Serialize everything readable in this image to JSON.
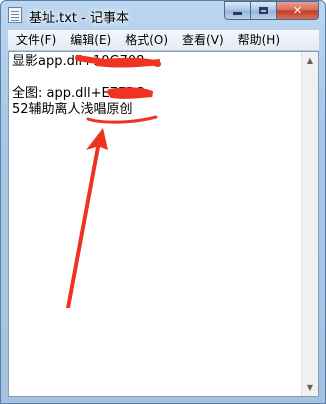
{
  "window": {
    "title": "基址.txt - 记事本",
    "close_glyph": "✕"
  },
  "menu": {
    "items": [
      {
        "label": "文件(F)"
      },
      {
        "label": "编辑(E)"
      },
      {
        "label": "格式(O)"
      },
      {
        "label": "查看(V)"
      },
      {
        "label": "帮助(H)"
      }
    ]
  },
  "editor": {
    "lines": [
      "显影app.dll+10G708",
      "",
      "全图: app.dll+E7EBC",
      "52辅助离人浅唱原创"
    ]
  },
  "annotation": {
    "color": "#ee3322",
    "scribble_lines": [
      1,
      3
    ],
    "underlined_text": "原创"
  }
}
